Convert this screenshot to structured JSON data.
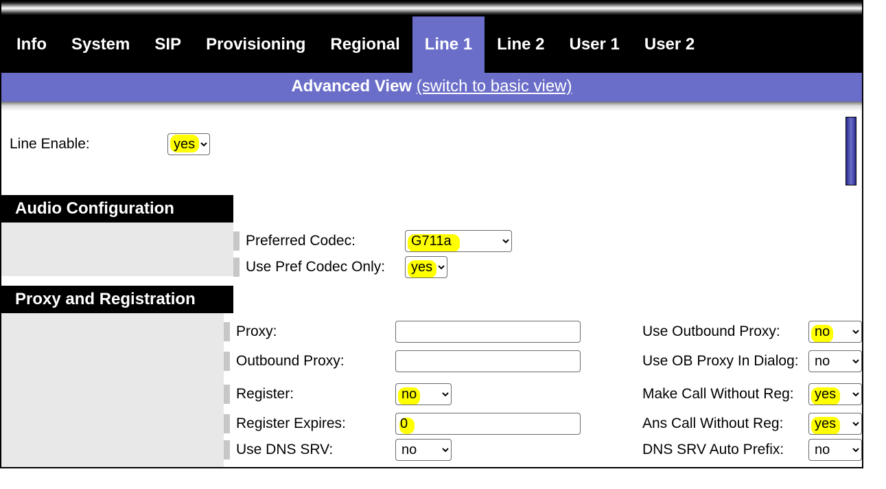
{
  "nav": {
    "items": [
      {
        "label": "Info",
        "active": false
      },
      {
        "label": "System",
        "active": false
      },
      {
        "label": "SIP",
        "active": false
      },
      {
        "label": "Provisioning",
        "active": false
      },
      {
        "label": "Regional",
        "active": false
      },
      {
        "label": "Line 1",
        "active": true
      },
      {
        "label": "Line 2",
        "active": false
      },
      {
        "label": "User 1",
        "active": false
      },
      {
        "label": "User 2",
        "active": false
      }
    ]
  },
  "view_bar": {
    "label": "Advanced View",
    "switch_text": "(switch to basic view)"
  },
  "line_enable": {
    "label": "Line Enable:",
    "value": "yes"
  },
  "sections": {
    "audio": {
      "title": "Audio Configuration",
      "preferred_codec": {
        "label": "Preferred Codec:",
        "value": "G711a"
      },
      "use_pref_codec_only": {
        "label": "Use Pref Codec Only:",
        "value": "yes"
      }
    },
    "proxy": {
      "title": "Proxy and Registration",
      "proxy": {
        "label": "Proxy:",
        "value": ""
      },
      "outbound_proxy": {
        "label": "Outbound Proxy:",
        "value": ""
      },
      "register": {
        "label": "Register:",
        "value": "no"
      },
      "register_expires": {
        "label": "Register Expires:",
        "value": "0"
      },
      "use_dns_srv": {
        "label": "Use DNS SRV:",
        "value": "no"
      },
      "use_outbound_proxy": {
        "label": "Use Outbound Proxy:",
        "value": "no"
      },
      "use_ob_proxy_in_dialog": {
        "label": "Use OB Proxy In Dialog:",
        "value": "no"
      },
      "make_call_without_reg": {
        "label": "Make Call Without Reg:",
        "value": "yes"
      },
      "ans_call_without_reg": {
        "label": "Ans Call Without Reg:",
        "value": "yes"
      },
      "dns_srv_auto_prefix": {
        "label": "DNS SRV Auto Prefix:",
        "value": "no"
      }
    }
  }
}
